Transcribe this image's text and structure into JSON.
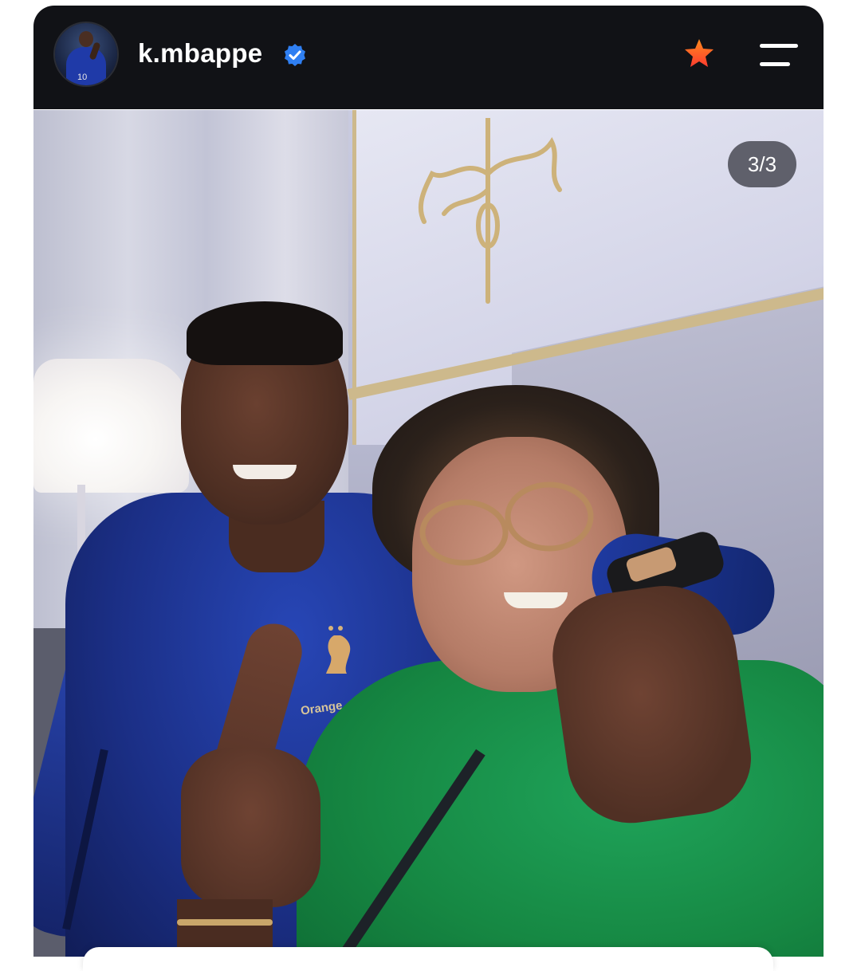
{
  "header": {
    "username": "k.mbappe",
    "avatar_icon": "profile-avatar",
    "avatar_jersey_number": "10",
    "verified_icon": "verified-badge-icon",
    "star_icon": "star-icon",
    "menu_icon": "hamburger-menu-icon"
  },
  "post": {
    "image_counter": "3/3",
    "sponsor_text": "Orange"
  },
  "colors": {
    "header_bg": "#111216",
    "verified_blue": "#2f7ff2",
    "star_orange": "#ff5a1f",
    "counter_bg": "#3c3e46"
  }
}
